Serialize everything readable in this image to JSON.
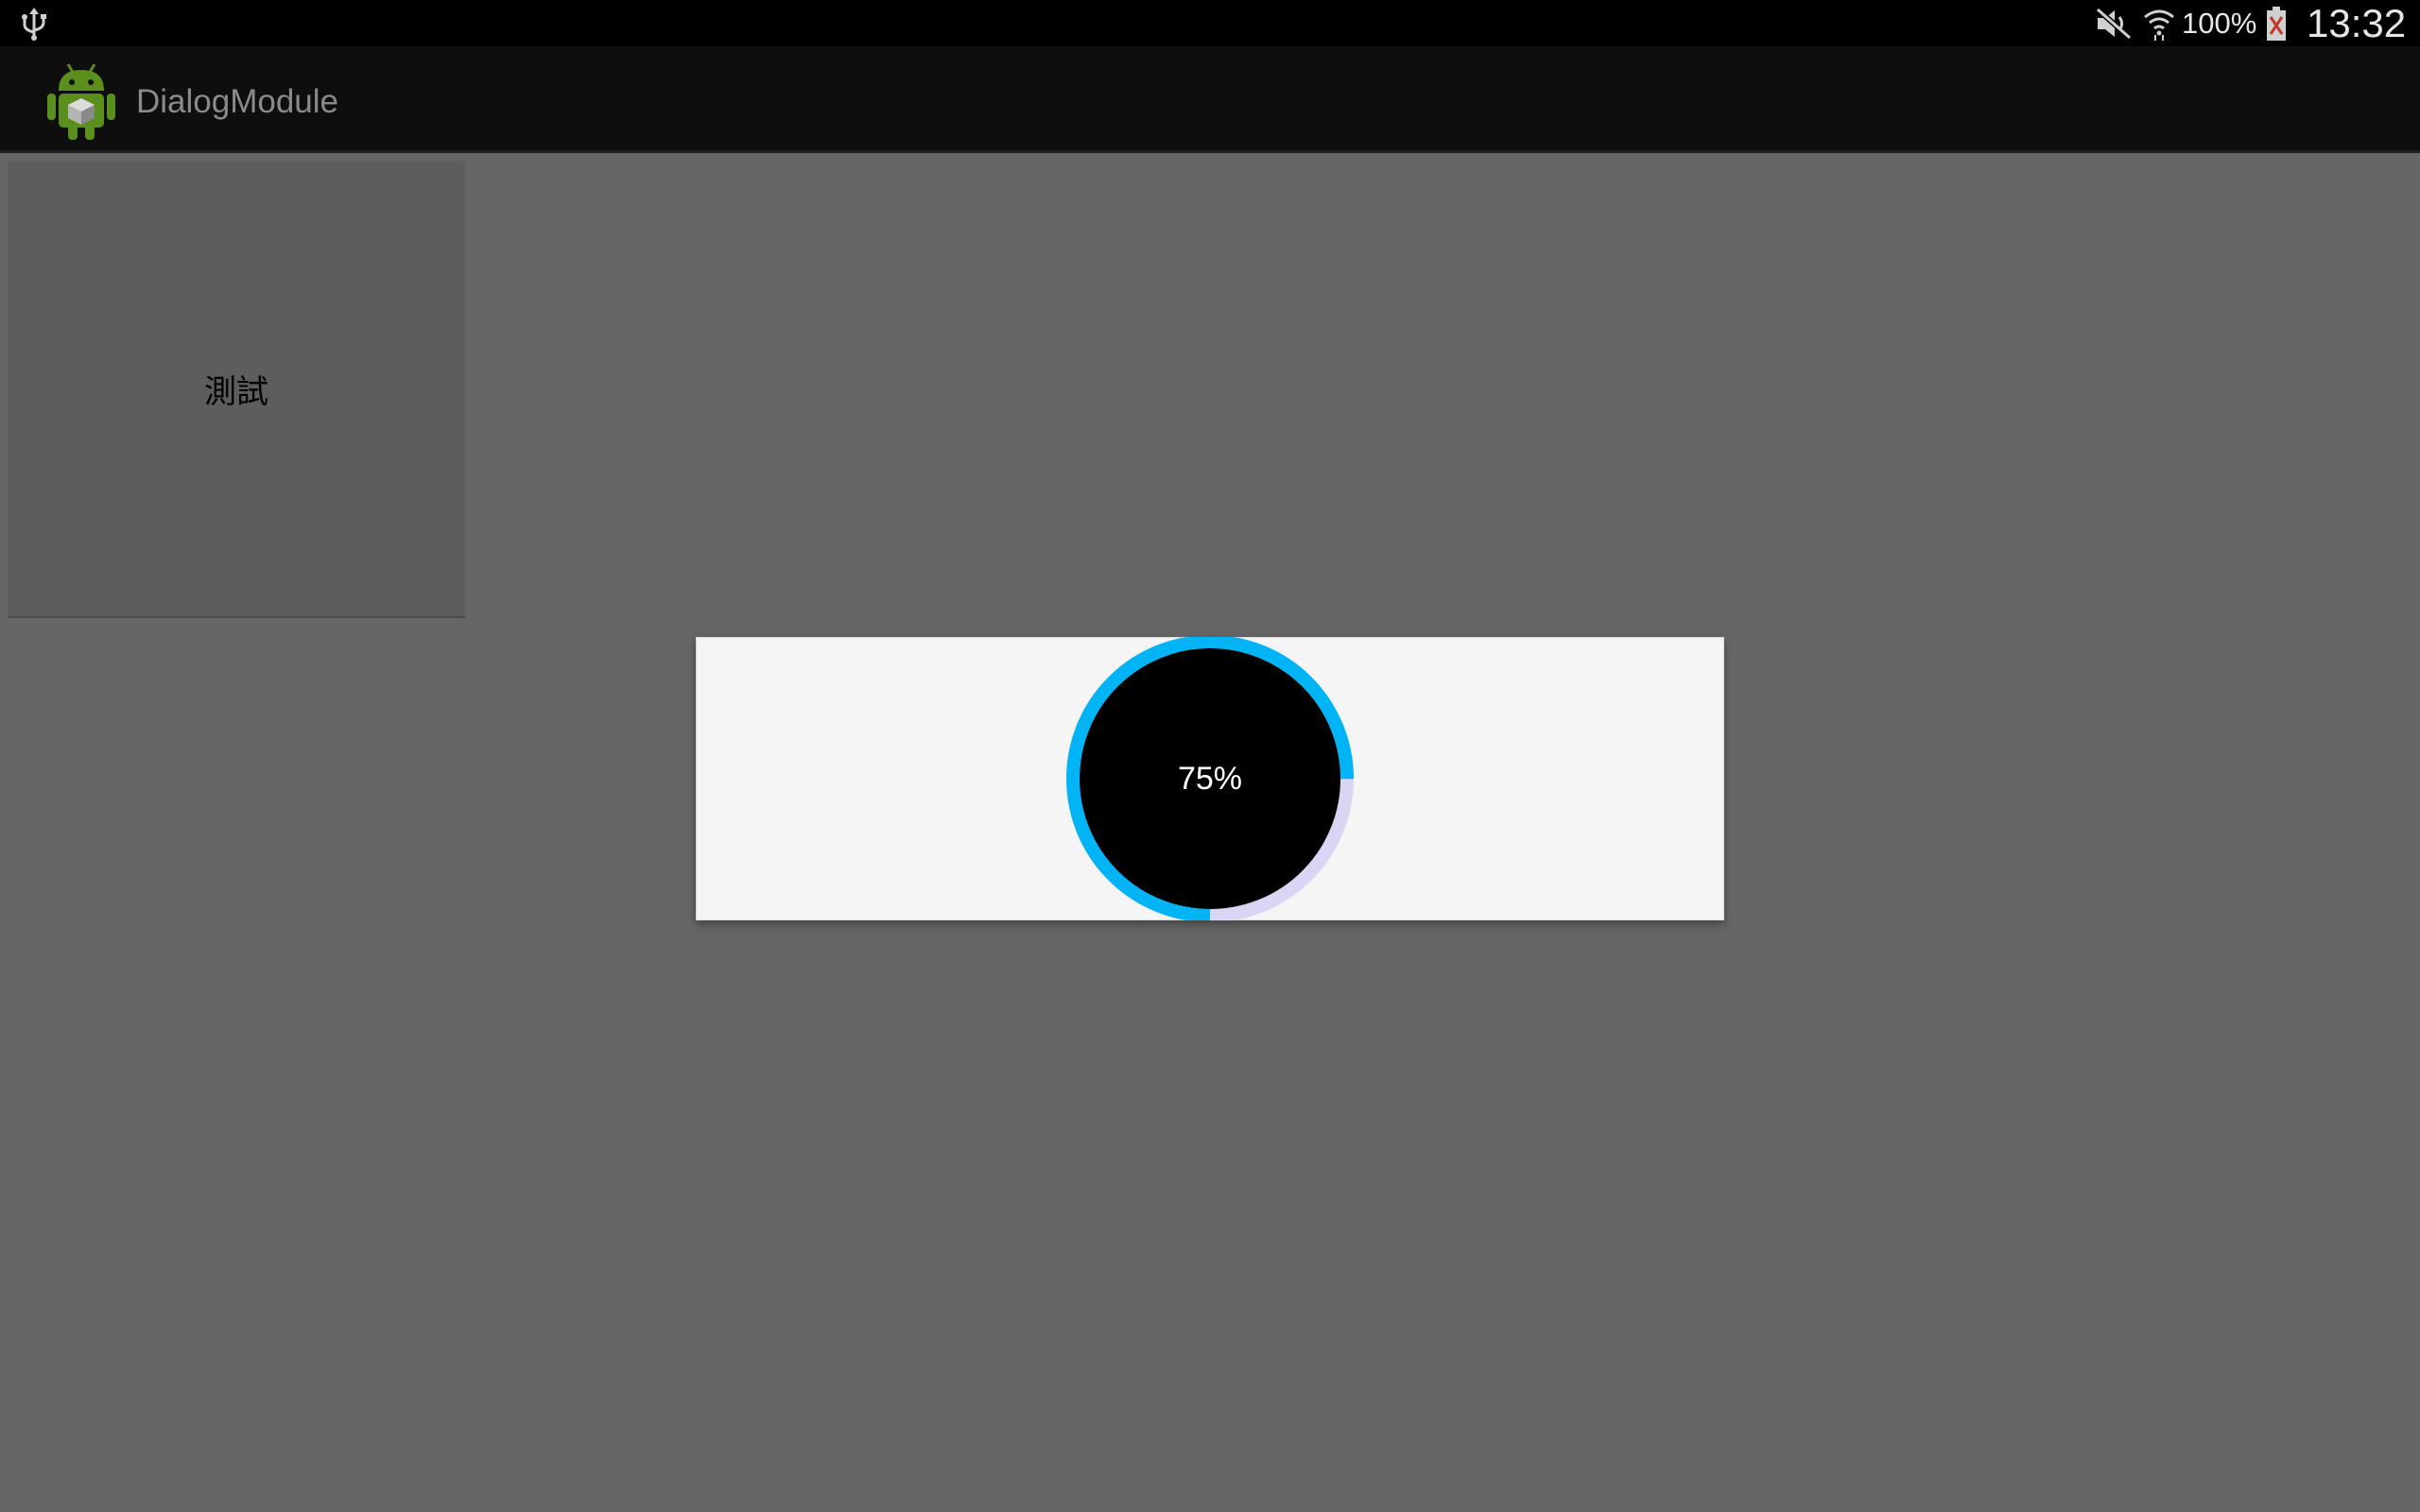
{
  "status_bar": {
    "battery_percent": "100%",
    "time": "13:32",
    "icons": [
      "usb-icon",
      "mute-icon",
      "wifi-icon",
      "battery-icon"
    ]
  },
  "action_bar": {
    "title": "DialogModule",
    "icon": "android-app-icon"
  },
  "main": {
    "test_button_label": "測試"
  },
  "progress_dialog": {
    "percent_label": "75%",
    "progress_fraction": 0.75,
    "colors": {
      "progress": "#00b4f5",
      "track": "#d9d6f5",
      "center": "#000000",
      "dialog_bg": "#f5f5f5"
    }
  }
}
